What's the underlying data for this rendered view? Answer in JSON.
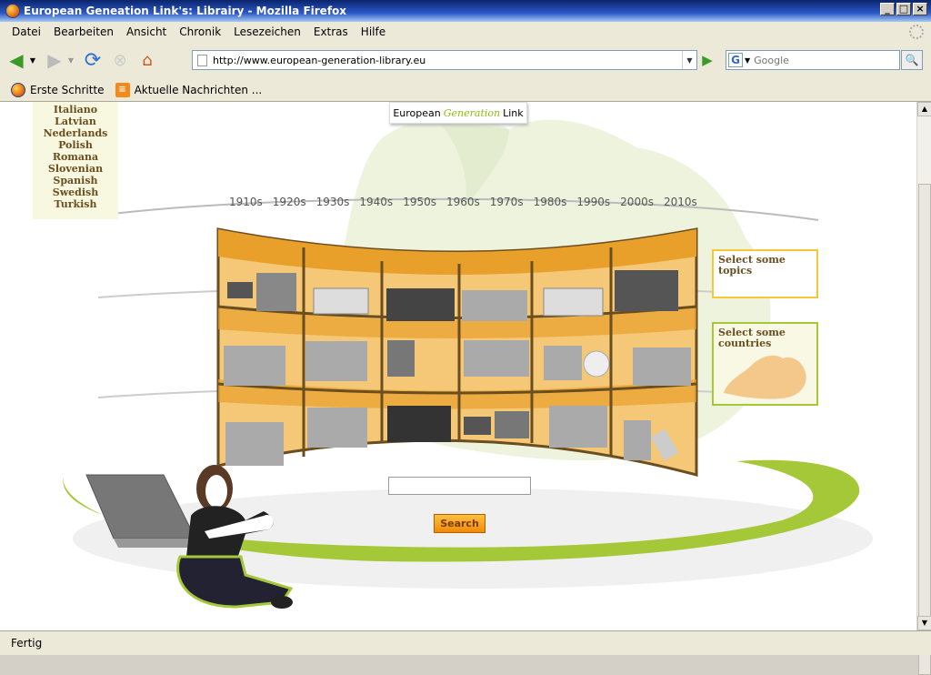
{
  "window": {
    "title": "European Geneation Link's: Librairy - Mozilla Firefox"
  },
  "menu": [
    "Datei",
    "Bearbeiten",
    "Ansicht",
    "Chronik",
    "Lesezeichen",
    "Extras",
    "Hilfe"
  ],
  "nav": {
    "url": "http://www.european-generation-library.eu",
    "search_placeholder": "Google",
    "search_engine_icon": "G"
  },
  "bookmarks": [
    {
      "label": "Erste Schritte",
      "icon": "firefox-icon"
    },
    {
      "label": "Aktuelle Nachrichten ...",
      "icon": "rss-icon"
    }
  ],
  "page": {
    "languages": [
      "Italiano",
      "Latvian",
      "Nederlands",
      "Polish",
      "Romana",
      "Slovenian",
      "Spanish",
      "Swedish",
      "Turkish"
    ],
    "logo": {
      "part1": "European",
      "part2": "Generation",
      "part3": "Link"
    },
    "decades": [
      "1910s",
      "1920s",
      "1930s",
      "1940s",
      "1950s",
      "1960s",
      "1970s",
      "1980s",
      "1990s",
      "2000s",
      "2010s"
    ],
    "topics_label": "Select some topics",
    "countries_label": "Select some countries",
    "search_button": "Search"
  },
  "status": {
    "text": "Fertig"
  },
  "colors": {
    "shelf_orange": "#e8a02a",
    "accent_green": "#a4c838",
    "text_brown": "#6b4e20"
  }
}
